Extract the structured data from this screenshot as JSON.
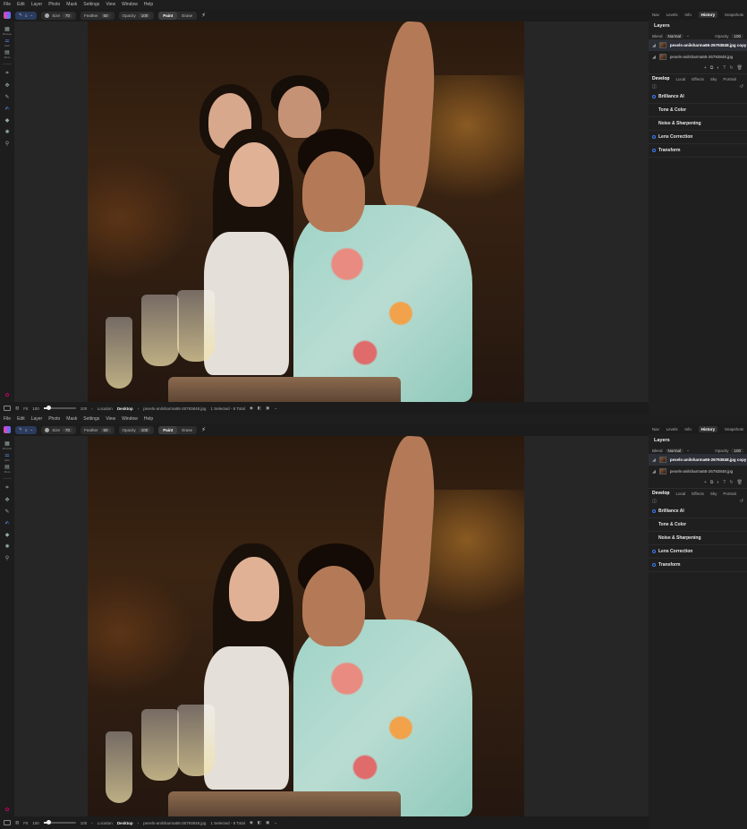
{
  "menu": [
    "File",
    "Edit",
    "Layer",
    "Photo",
    "Mask",
    "Settings",
    "View",
    "Window",
    "Help"
  ],
  "toolbar": {
    "size_label": "Size",
    "size_value": "70",
    "feather_label": "Feather",
    "feather_value": "50",
    "opacity_label": "Opacity",
    "opacity_value": "100",
    "paint_label": "Paint",
    "erase_label": "Erase"
  },
  "rail": {
    "items": [
      {
        "icon": "grid-icon",
        "label": "Browse"
      },
      {
        "icon": "sliders-icon",
        "label": "Edit"
      },
      {
        "icon": "layers-icon",
        "label": "More"
      }
    ]
  },
  "panel": {
    "tabs": [
      "Nav",
      "Levels",
      "Info",
      "History",
      "Snapshots"
    ],
    "active_tab": "History",
    "layers_title": "Layers",
    "blend_label": "Blend",
    "blend_value": "Normal",
    "opacity_label": "Opacity",
    "opacity_value": "100",
    "layers": [
      {
        "name": "pexels-anilsharma65-26793848.jpg copy",
        "selected": true
      },
      {
        "name": "pexels-anilsharma65-26793848.jpg",
        "selected": false
      }
    ],
    "dev_tabs": [
      "Develop",
      "Local",
      "Effects",
      "Sky",
      "Portrait"
    ],
    "sections": [
      "Brilliance AI",
      "Tone & Color",
      "Noise & Sharpening",
      "Lens Correction",
      "Transform"
    ]
  },
  "statusbar": {
    "fit_label": "Fit",
    "fit_value": "100",
    "zoom_value": "100",
    "location_label": "Location",
    "location_value": "Desktop",
    "file": "pexels-anilsharma65-26793848.jpg",
    "selection": "1 Selected - 8 Total"
  },
  "colors": {
    "accent": "#2f6fe0",
    "brush_active": "#2a3b5e",
    "panel_bg": "#1f1f1f"
  }
}
